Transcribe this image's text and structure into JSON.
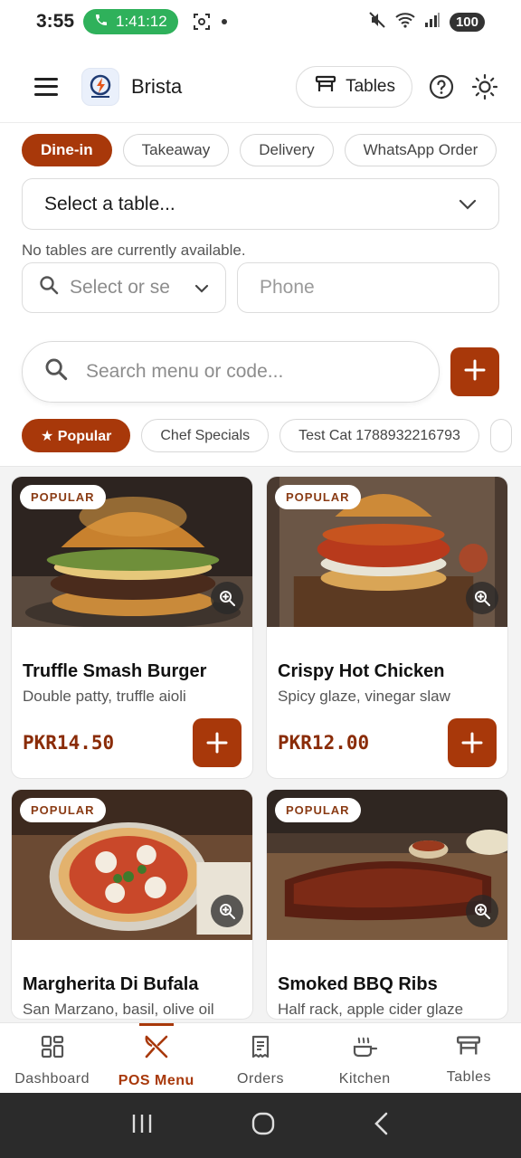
{
  "status_bar": {
    "time": "3:55",
    "call_duration": "1:41:12",
    "battery": "100"
  },
  "header": {
    "app_name": "Brista",
    "tables_button": "Tables"
  },
  "order_types": [
    {
      "label": "Dine-in",
      "active": true
    },
    {
      "label": "Takeaway",
      "active": false
    },
    {
      "label": "Delivery",
      "active": false
    },
    {
      "label": "WhatsApp Order",
      "active": false
    }
  ],
  "table_select": {
    "placeholder": "Select a table...",
    "empty_message": "No tables are currently available."
  },
  "customer": {
    "select_placeholder": "Select or se",
    "phone_placeholder": "Phone"
  },
  "search": {
    "placeholder": "Search menu or code..."
  },
  "categories": [
    {
      "label": "★ Popular",
      "active": true
    },
    {
      "label": "Chef Specials",
      "active": false
    },
    {
      "label": "Test Cat 1788932216793",
      "active": false
    }
  ],
  "menu_items": [
    {
      "badge": "POPULAR",
      "name": "Truffle Smash Burger",
      "description": "Double patty, truffle aioli",
      "price": "PKR14.50"
    },
    {
      "badge": "POPULAR",
      "name": "Crispy Hot Chicken",
      "description": "Spicy glaze, vinegar slaw",
      "price": "PKR12.00"
    },
    {
      "badge": "POPULAR",
      "name": "Margherita Di Bufala",
      "description": "San Marzano, basil, olive oil",
      "price": ""
    },
    {
      "badge": "POPULAR",
      "name": "Smoked BBQ Ribs",
      "description": "Half rack, apple cider glaze",
      "price": ""
    }
  ],
  "bottom_nav": [
    {
      "label": "Dashboard",
      "icon": "dashboard-icon",
      "active": false
    },
    {
      "label": "POS Menu",
      "icon": "utensils-icon",
      "active": true
    },
    {
      "label": "Orders",
      "icon": "receipt-icon",
      "active": false
    },
    {
      "label": "Kitchen",
      "icon": "cooking-pot-icon",
      "active": false
    },
    {
      "label": "Tables",
      "icon": "table-icon",
      "active": false
    }
  ],
  "colors": {
    "accent": "#a8380a",
    "call_green": "#2fb15b",
    "price": "#8a2c08"
  }
}
